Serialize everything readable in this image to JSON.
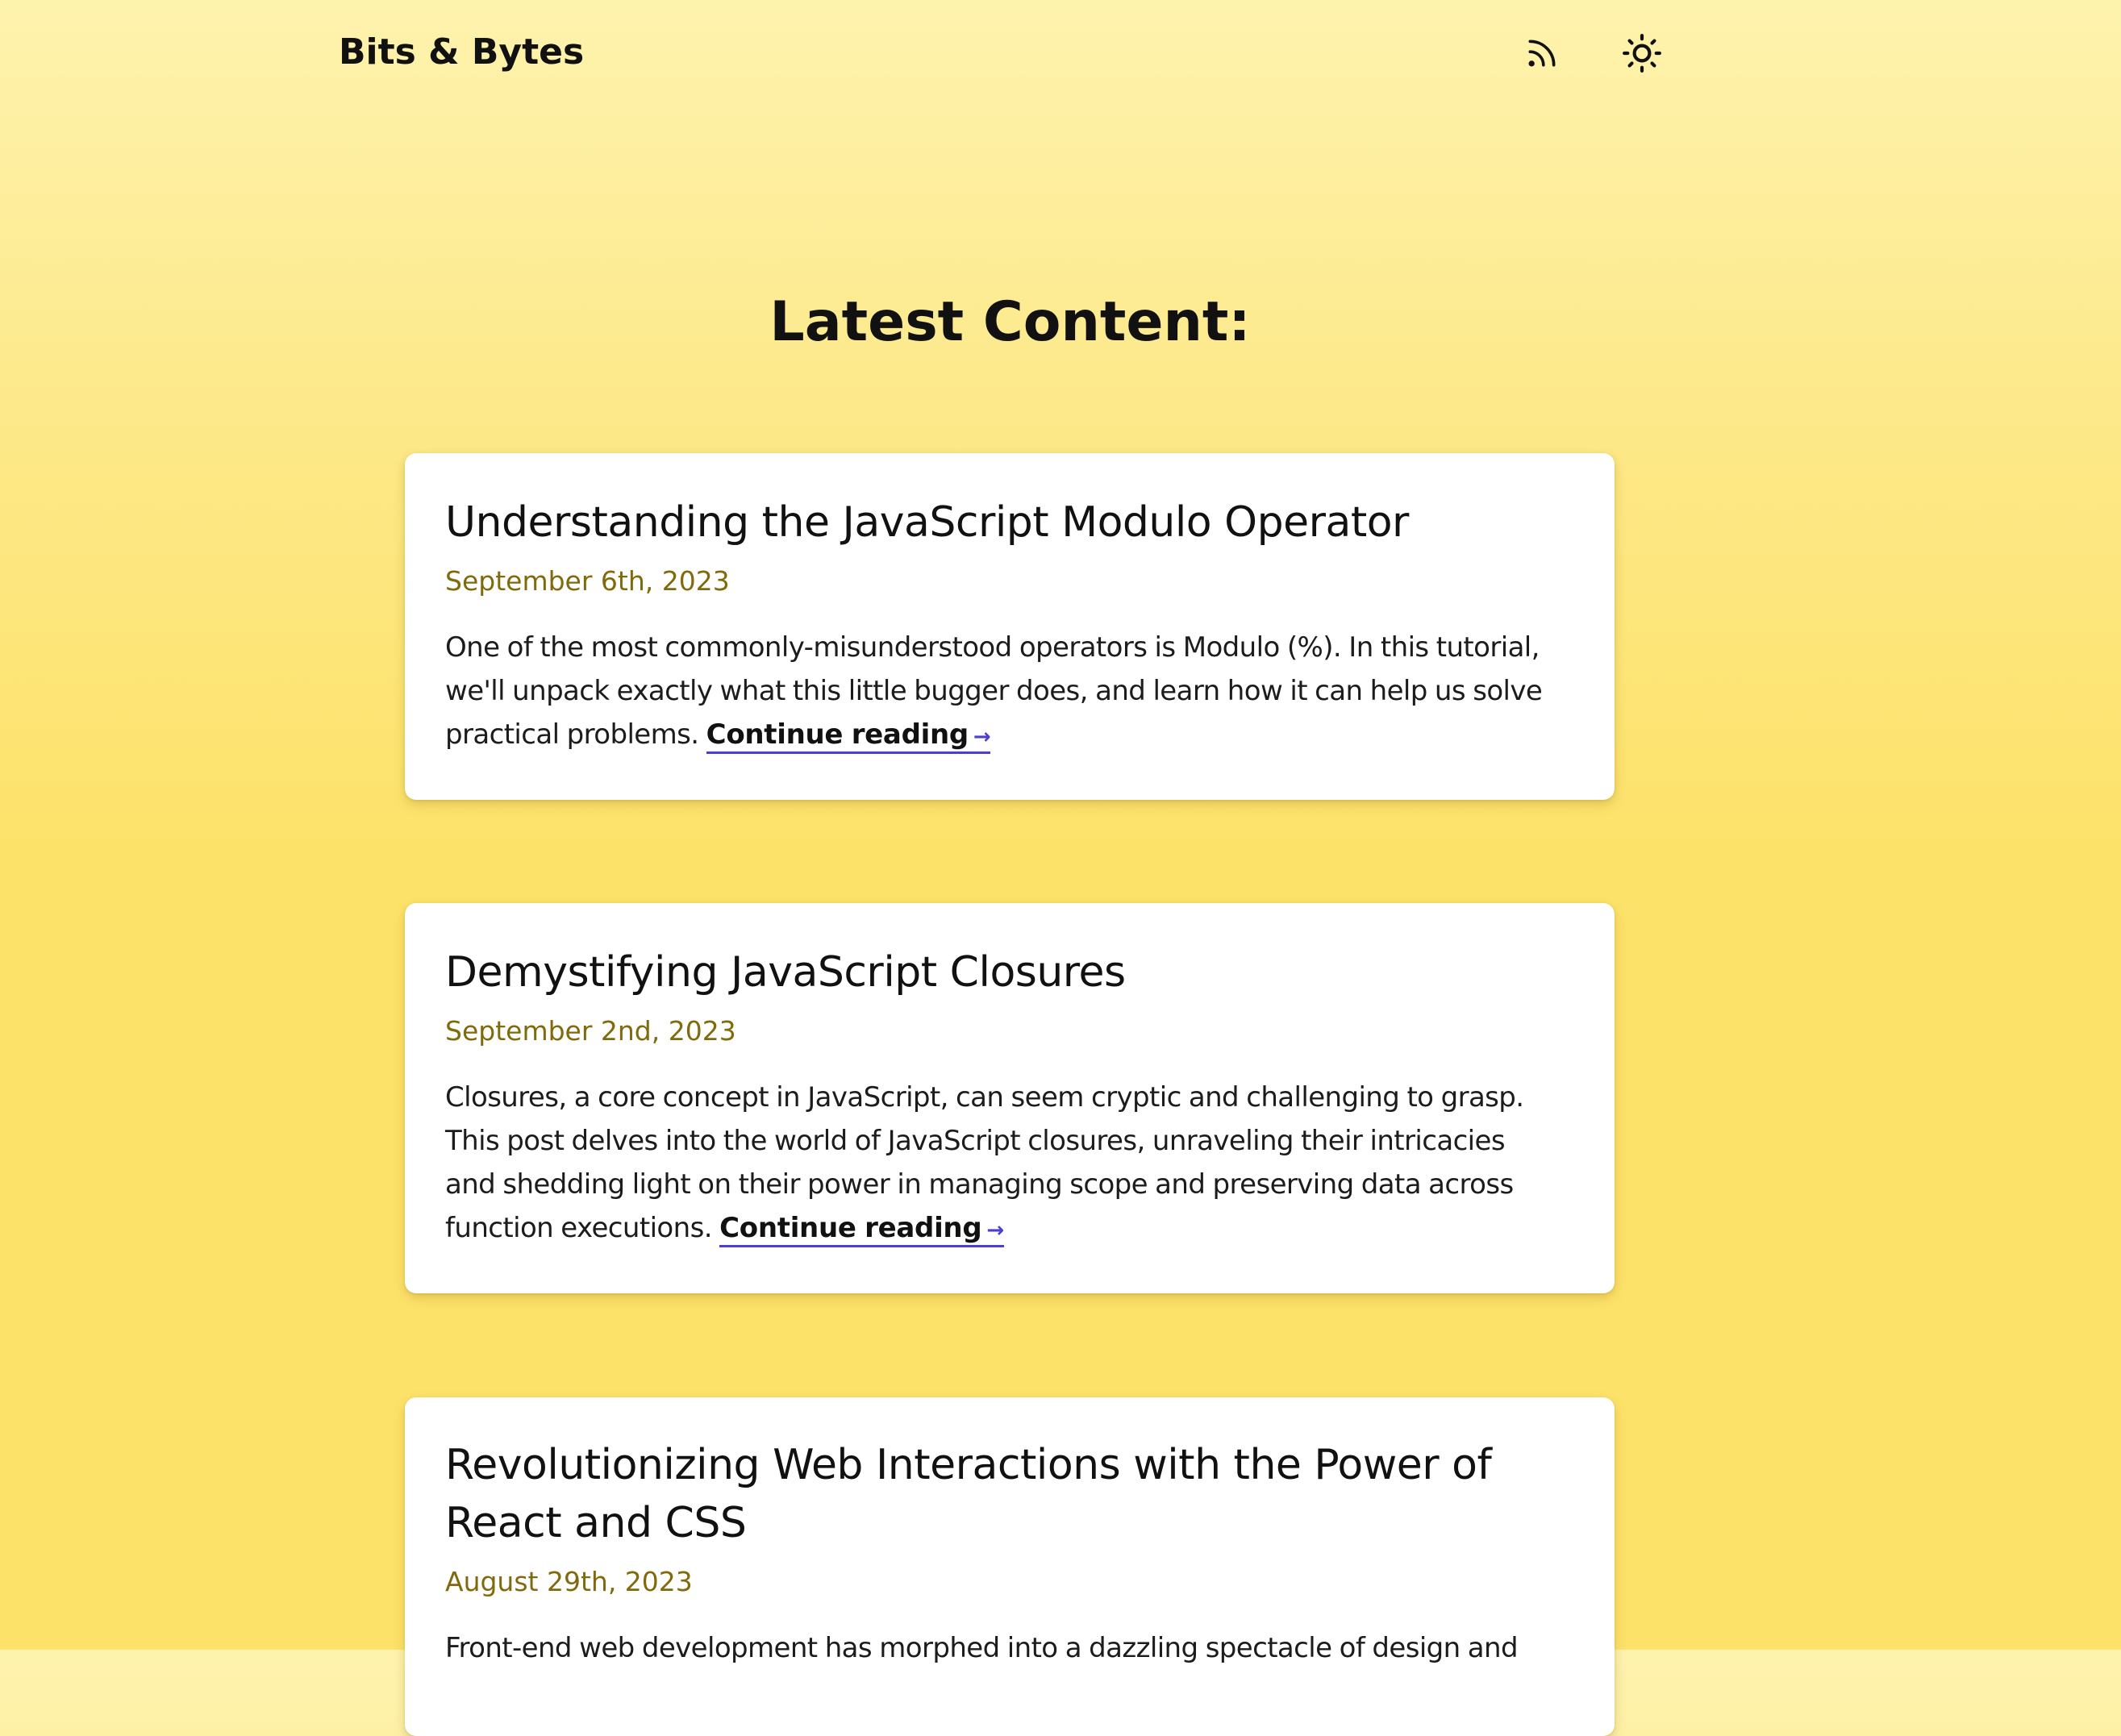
{
  "header": {
    "site_title": "Bits & Bytes",
    "rss_icon": "rss-icon",
    "theme_icon": "sun-icon"
  },
  "main": {
    "heading": "Latest Content:"
  },
  "posts": [
    {
      "title": "Understanding the JavaScript Modulo Operator",
      "date": "September 6th, 2023",
      "excerpt_lines": [
        "One of the most commonly-misunderstood operators is Modulo (%). In this tutorial,",
        "we'll unpack exactly what this little bugger does, and learn how it can help us solve",
        "practical problems."
      ],
      "link_label": "Continue reading"
    },
    {
      "title": "Demystifying JavaScript Closures",
      "date": "September 2nd, 2023",
      "excerpt_lines": [
        "Closures, a core concept in JavaScript, can seem cryptic and challenging to grasp.",
        "This post delves into the world of JavaScript closures, unraveling their intricacies",
        "and shedding light on their power in managing scope and preserving data across",
        "function executions."
      ],
      "link_label": "Continue reading"
    },
    {
      "title_lines": [
        "Revolutionizing Web Interactions with the Power of",
        "React and CSS"
      ],
      "date": "August 29th, 2023",
      "excerpt_lines": [
        "Front-end web development has morphed into a dazzling spectacle of design and"
      ]
    }
  ],
  "colors": {
    "accent": "#4a3fd0",
    "date": "#806a0b",
    "background_top": "#fef3ae",
    "background_bottom": "#fde26a"
  }
}
